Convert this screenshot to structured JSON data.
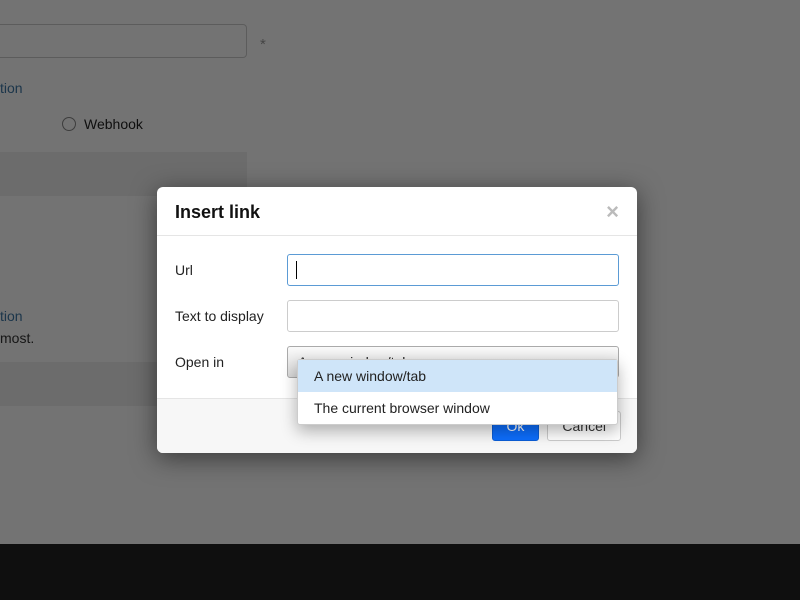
{
  "background": {
    "section1_label": "tion",
    "radio_label": "Webhook",
    "section2_label": "tion",
    "caption_tail": "most."
  },
  "modal": {
    "title": "Insert link",
    "close_glyph": "×",
    "fields": {
      "url": {
        "label": "Url",
        "value": ""
      },
      "text": {
        "label": "Text to display",
        "value": ""
      },
      "open_in": {
        "label": "Open in",
        "selected": "A new window/tab",
        "options": [
          "A new window/tab",
          "The current browser window"
        ]
      }
    },
    "buttons": {
      "ok": "Ok",
      "cancel": "Cancel"
    }
  }
}
